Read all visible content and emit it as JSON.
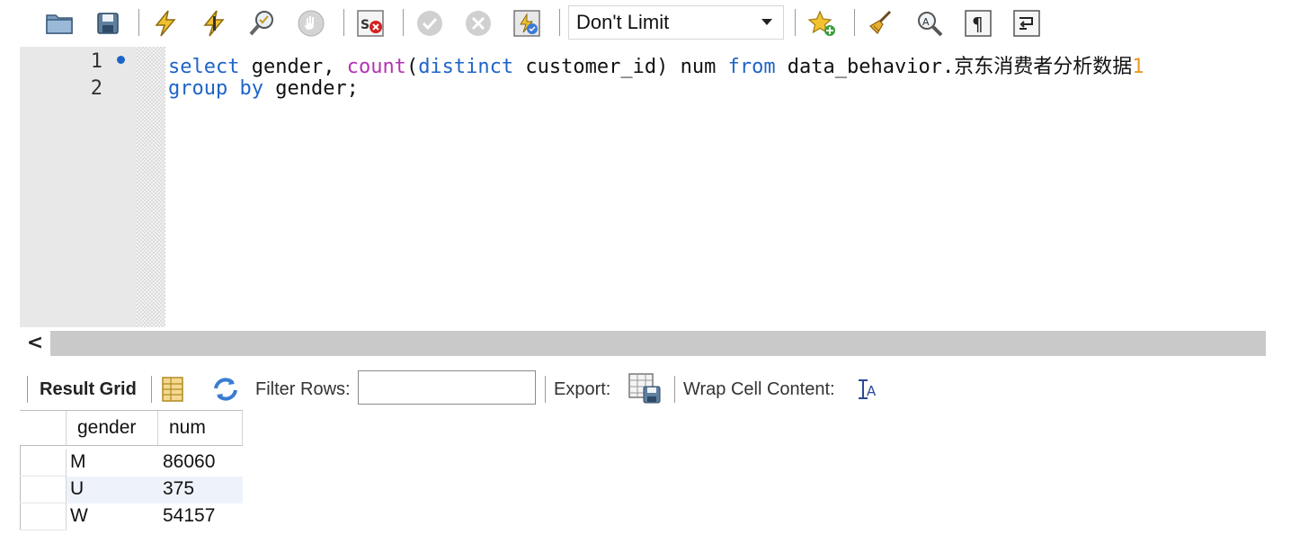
{
  "toolbar": {
    "icons": [
      "open-folder-icon",
      "save-icon",
      "execute-icon",
      "execute-current-icon",
      "explain-icon",
      "stop-icon",
      "toggle-error-icon",
      "commit-icon",
      "rollback-icon",
      "autocommit-icon",
      "add-snippet-icon",
      "beautify-icon",
      "find-icon",
      "invisible-chars-icon",
      "wrap-icon"
    ],
    "limit_value": "Don't Limit"
  },
  "editor": {
    "line_numbers": [
      "1",
      "2"
    ],
    "line1": {
      "p1": "select",
      "p2": " gender, ",
      "p3": "count",
      "p4": "(",
      "p5": "distinct",
      "p6": " customer_id) num ",
      "p7": "from",
      "p8": " data_behavior.京东消费者分析数据",
      "p9": "1"
    },
    "line2": {
      "p1": "group by",
      "p2": " gender;"
    },
    "colors": {
      "keyword": "#1e64c8",
      "function": "#b432b4",
      "number": "#e69b1e"
    }
  },
  "scrollbar": {
    "left_arrow": "<"
  },
  "result_bar": {
    "result_grid_label": "Result Grid",
    "filter_label": "Filter Rows:",
    "filter_value": "",
    "export_label": "Export:",
    "wrap_label": "Wrap Cell Content:"
  },
  "grid": {
    "columns": [
      "gender",
      "num"
    ],
    "rows": [
      {
        "gender": "M",
        "num": "86060"
      },
      {
        "gender": "U",
        "num": "375"
      },
      {
        "gender": "W",
        "num": "54157"
      }
    ],
    "selected_row_index": 1,
    "selected_row_color": "#eef3fb"
  }
}
